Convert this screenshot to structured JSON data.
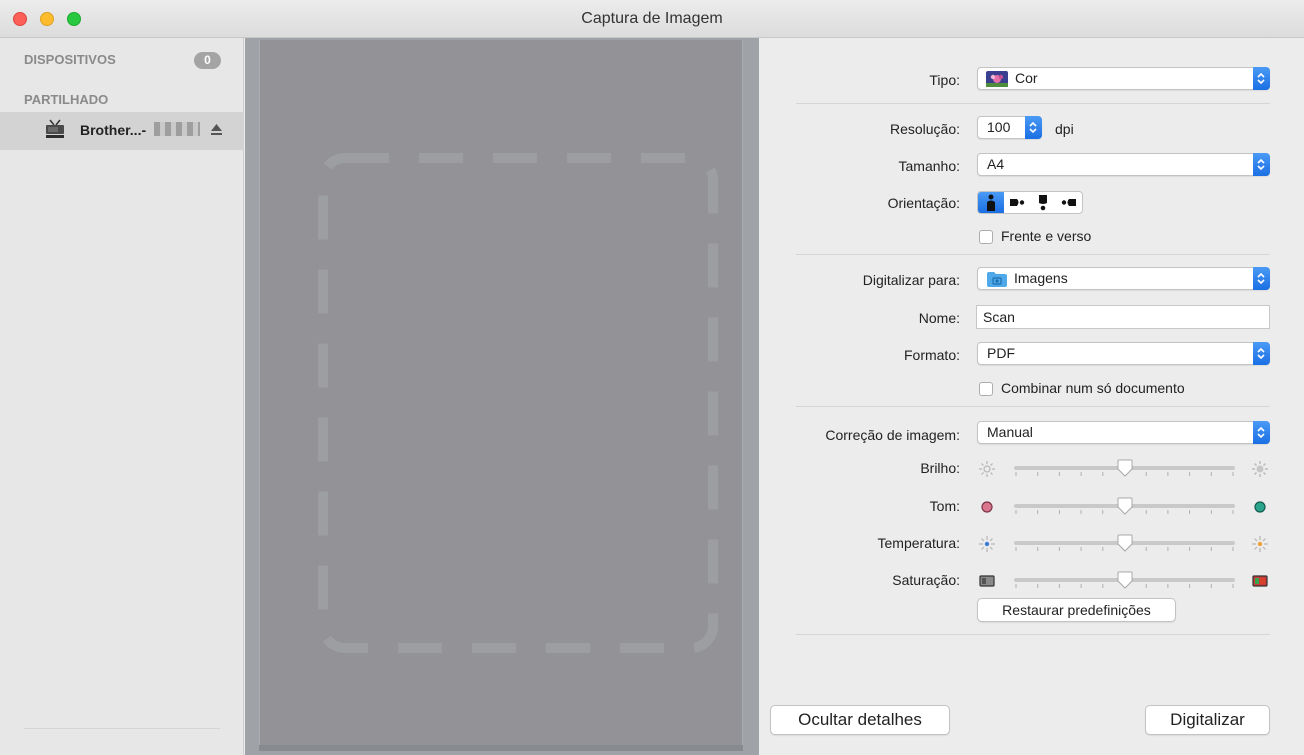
{
  "window": {
    "title": "Captura de Imagem"
  },
  "sidebar": {
    "devices_header": "DISPOSITIVOS",
    "devices_count": "0",
    "shared_header": "PARTILHADO",
    "shared_items": [
      {
        "label": "Brother...-"
      }
    ]
  },
  "settings": {
    "tipo": {
      "label": "Tipo:",
      "value": "Cor"
    },
    "resolucao": {
      "label": "Resolução:",
      "value": "100",
      "unit": "dpi"
    },
    "tamanho": {
      "label": "Tamanho:",
      "value": "A4"
    },
    "orientacao": {
      "label": "Orientação:",
      "selected_index": 0
    },
    "frente_verso": {
      "label": "Frente e verso",
      "checked": false
    },
    "digitalizar_para": {
      "label": "Digitalizar para:",
      "value": "Imagens"
    },
    "nome": {
      "label": "Nome:",
      "value": "Scan"
    },
    "formato": {
      "label": "Formato:",
      "value": "PDF"
    },
    "combinar": {
      "label": "Combinar num só documento",
      "checked": false
    },
    "correcao": {
      "label": "Correção de imagem:",
      "value": "Manual"
    },
    "sliders": [
      {
        "key": "brilho",
        "label": "Brilho:",
        "value": 0.5
      },
      {
        "key": "tom",
        "label": "Tom:",
        "value": 0.5
      },
      {
        "key": "temperatura",
        "label": "Temperatura:",
        "value": 0.5
      },
      {
        "key": "saturacao",
        "label": "Saturação:",
        "value": 0.5
      }
    ],
    "restore_label": "Restaurar predefinições"
  },
  "footer": {
    "hide_details_label": "Ocultar detalhes",
    "scan_label": "Digitalizar"
  },
  "colors": {
    "accent": "#1a6fe3",
    "preview_bg": "#9fa3a8",
    "paper": "#939397"
  }
}
